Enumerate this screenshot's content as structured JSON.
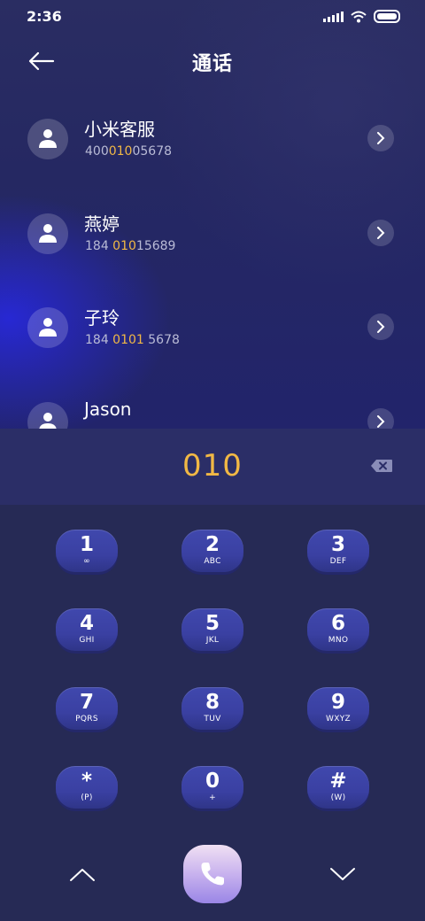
{
  "status_bar": {
    "time": "2:36"
  },
  "header": {
    "title": "通话"
  },
  "contacts": [
    {
      "name": "小米客服",
      "number_pre": "400",
      "number_match": "010",
      "number_post": "05678"
    },
    {
      "name": "燕婷",
      "number_pre": "184 ",
      "number_match": "010",
      "number_post": "15689"
    },
    {
      "name": "子玲",
      "number_pre": "184 ",
      "number_match": "0101",
      "number_post": " 5678"
    },
    {
      "name": "Jason",
      "number_pre": "",
      "number_match": "",
      "number_post": ""
    }
  ],
  "dial_display": {
    "digits": "010"
  },
  "keypad": [
    {
      "num": "1",
      "sub": "∞"
    },
    {
      "num": "2",
      "sub": "ABC"
    },
    {
      "num": "3",
      "sub": "DEF"
    },
    {
      "num": "4",
      "sub": "GHI"
    },
    {
      "num": "5",
      "sub": "JKL"
    },
    {
      "num": "6",
      "sub": "MNO"
    },
    {
      "num": "7",
      "sub": "PQRS"
    },
    {
      "num": "8",
      "sub": "TUV"
    },
    {
      "num": "9",
      "sub": "WXYZ"
    },
    {
      "num": "*",
      "sub": "(P)"
    },
    {
      "num": "0",
      "sub": "+"
    },
    {
      "num": "#",
      "sub": "(W)"
    }
  ],
  "colors": {
    "accent": "#f1b845",
    "key": "#3a40a2",
    "call_button": "#c8b2ee"
  },
  "icons": [
    "back-arrow-icon",
    "contact-avatar-icon",
    "chevron-right-icon",
    "backspace-icon",
    "chevron-up-icon",
    "chevron-down-icon",
    "phone-icon",
    "signal-icon",
    "wifi-icon",
    "battery-icon"
  ]
}
